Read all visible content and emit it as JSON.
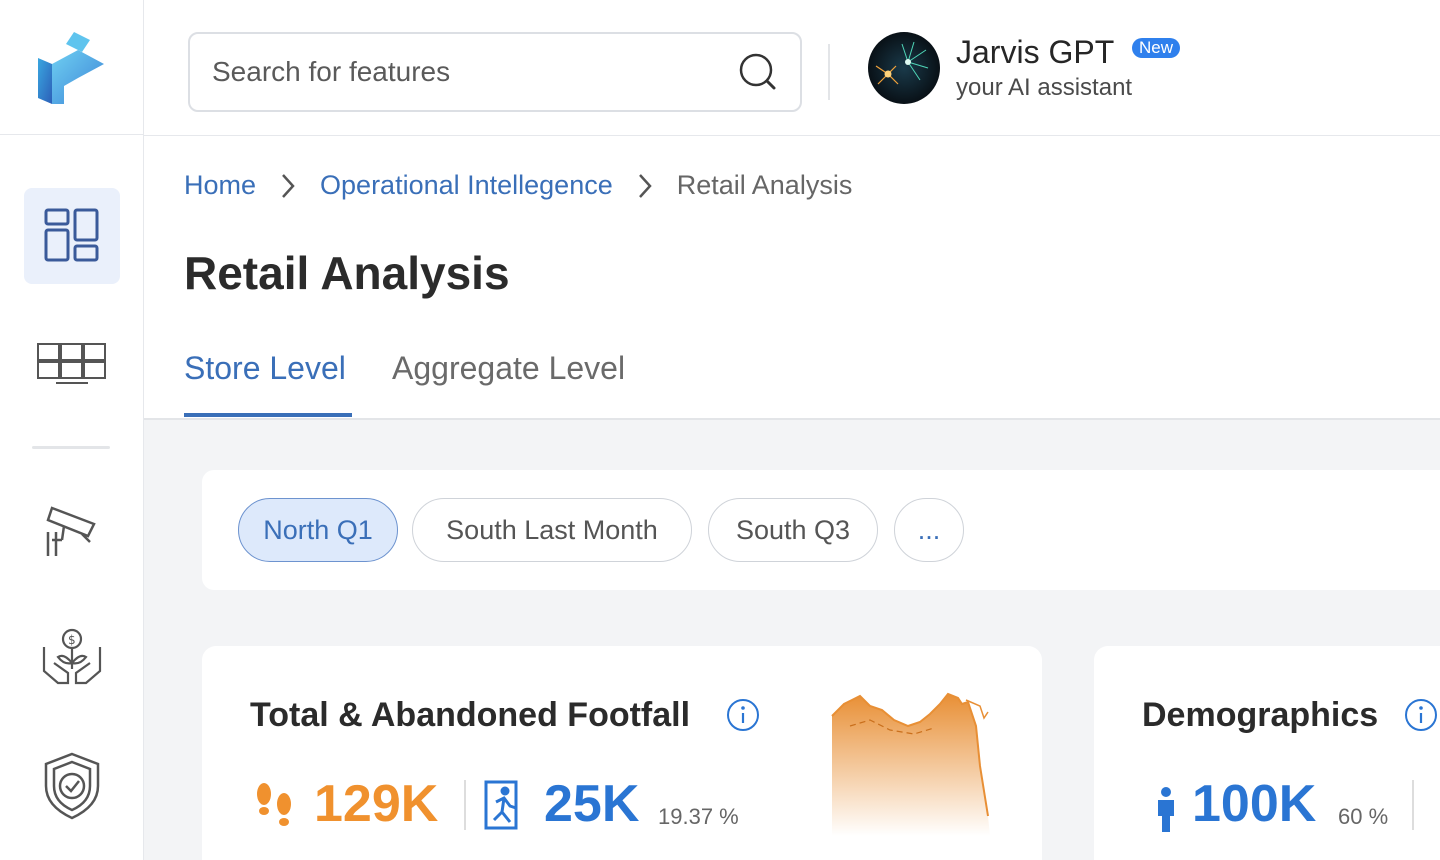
{
  "search": {
    "placeholder": "Search for features"
  },
  "assistant": {
    "name": "Jarvis GPT",
    "badge": "New",
    "subtitle": "your AI assistant"
  },
  "breadcrumb": {
    "home": "Home",
    "section": "Operational Intellegence",
    "current": "Retail Analysis"
  },
  "page": {
    "title": "Retail Analysis"
  },
  "tabs": {
    "store": "Store Level",
    "aggregate": "Aggregate Level"
  },
  "filters": {
    "chips": [
      "North Q1",
      "South Last Month",
      "South Q3",
      "..."
    ],
    "selected": "North Q1"
  },
  "cards": {
    "footfall": {
      "title": "Total & Abandoned Footfall",
      "total": "129K",
      "abandoned": "25K",
      "abandoned_pct": "19.37 %"
    },
    "demographics": {
      "title": "Demographics",
      "count": "100K",
      "pct": "60 %"
    }
  },
  "colors": {
    "accent": "#3a6fb8",
    "orange": "#f0912e",
    "blue_metric": "#2a75d3",
    "active_nav_bg": "#eaf0fb"
  },
  "sidebar": {
    "icons": [
      "dashboard-icon",
      "video-wall-icon",
      "cctv-camera-icon",
      "investment-icon",
      "security-shield-icon"
    ]
  }
}
